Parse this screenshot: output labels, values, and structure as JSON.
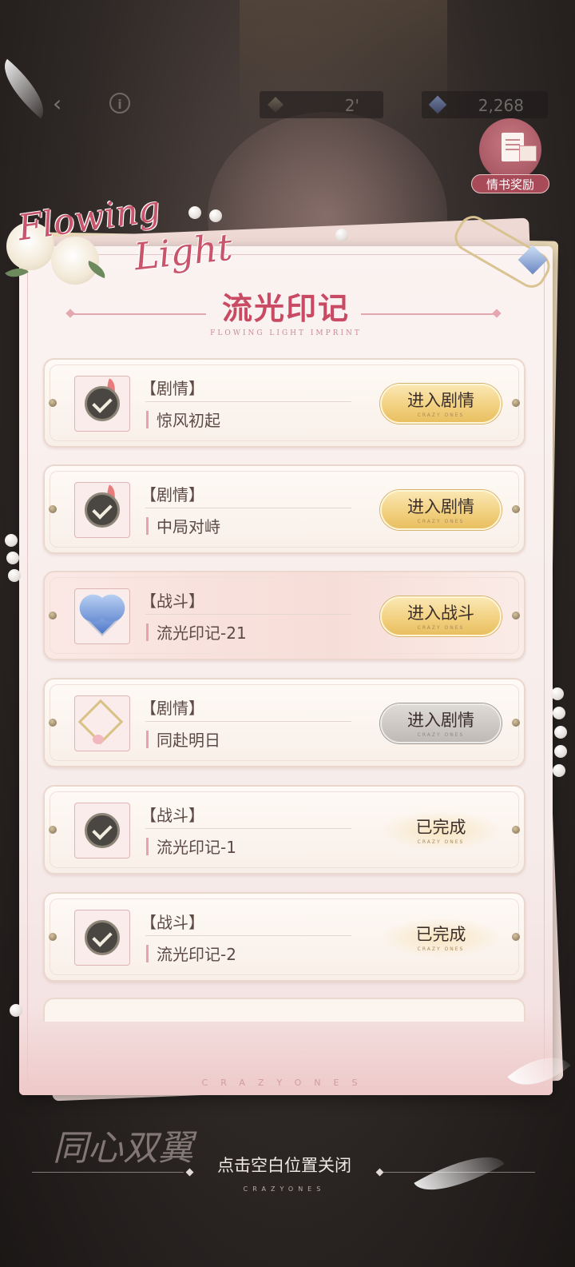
{
  "topbar": {
    "currencies": [
      {
        "icon": "feather-token-icon",
        "value": "2'"
      },
      {
        "icon": "diamond-icon",
        "value": "2,268"
      }
    ]
  },
  "reward": {
    "label": "情书奖励",
    "icon": "love-letter-gift-icon"
  },
  "logo": {
    "line1": "Flowing",
    "line2": "Light"
  },
  "header": {
    "title": "流光印记",
    "subtitle": "FLOWING LIGHT IMPRINT"
  },
  "entries": [
    {
      "type": "【剧情】",
      "name": "惊风初起",
      "action": "进入剧情",
      "action_sub": "CRAZY ONES",
      "state": "enter",
      "icon": "check-badge-icon"
    },
    {
      "type": "【剧情】",
      "name": "中局对峙",
      "action": "进入剧情",
      "action_sub": "CRAZY ONES",
      "state": "enter",
      "icon": "check-badge-icon"
    },
    {
      "type": "【战斗】",
      "name": "流光印记-21",
      "action": "进入战斗",
      "action_sub": "CRAZY ONES",
      "state": "enter",
      "icon": "blue-heart-gem-icon"
    },
    {
      "type": "【剧情】",
      "name": "同赴明日",
      "action": "进入剧情",
      "action_sub": "CRAZY ONES",
      "state": "locked",
      "icon": "golden-frame-icon"
    },
    {
      "type": "【战斗】",
      "name": "流光印记-1",
      "action": "已完成",
      "action_sub": "CRAZY ONES",
      "state": "done",
      "icon": "check-badge-icon"
    },
    {
      "type": "【战斗】",
      "name": "流光印记-2",
      "action": "已完成",
      "action_sub": "CRAZY ONES",
      "state": "done",
      "icon": "check-badge-icon"
    }
  ],
  "panel_brand": "CRAZYONES",
  "bottom": {
    "event_logo": "同心双翼",
    "close_hint": "点击空白位置关闭",
    "close_sub": "CRAZYONES"
  }
}
